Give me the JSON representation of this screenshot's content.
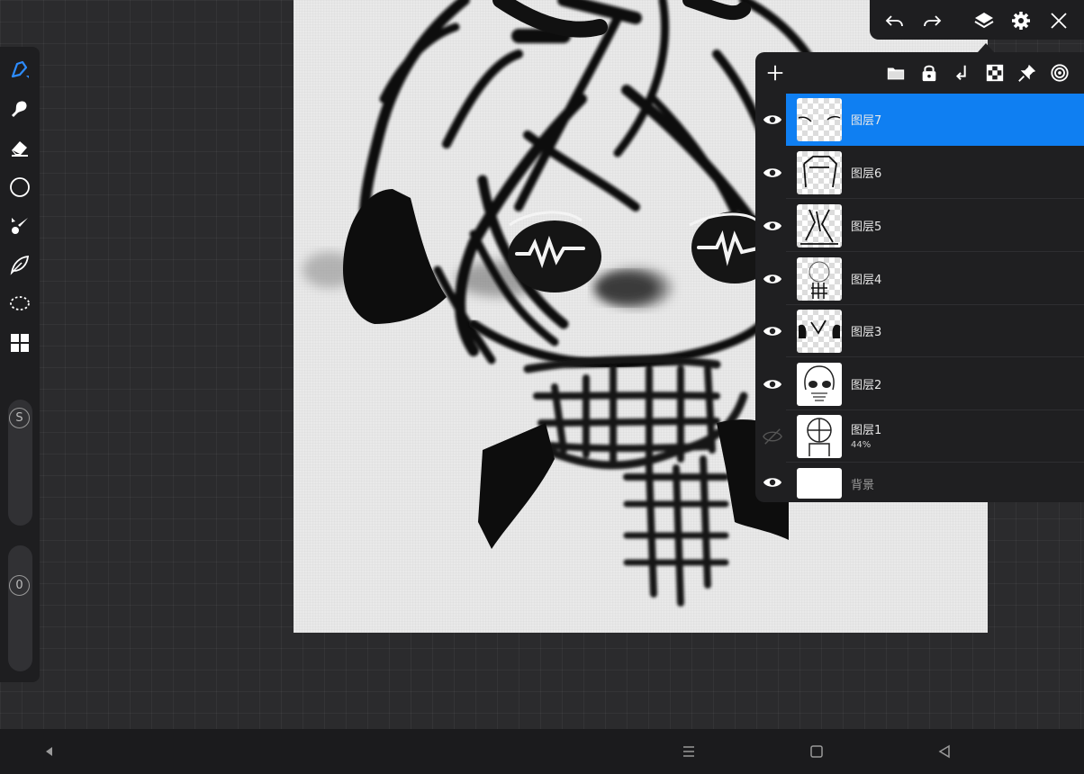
{
  "toolbar": {
    "tools": [
      {
        "name": "brush-icon",
        "active": true
      },
      {
        "name": "smudge-icon"
      },
      {
        "name": "eraser-icon"
      },
      {
        "name": "shape-circle-icon"
      },
      {
        "name": "fill-brush-icon"
      },
      {
        "name": "leaf-icon"
      },
      {
        "name": "lasso-icon"
      },
      {
        "name": "grid-icon"
      }
    ],
    "size_slider_label": "S",
    "opacity_slider_label": "0"
  },
  "topbar": {
    "icons": [
      "undo-icon",
      "redo-icon",
      "layers-icon",
      "settings-icon",
      "close-icon"
    ]
  },
  "layers_panel": {
    "header_icons": [
      "add-icon",
      "folder-icon",
      "lock-icon",
      "merge-down-icon",
      "checker-icon",
      "pin-icon",
      "target-icon"
    ],
    "layers": [
      {
        "name": "图层7",
        "visible": true,
        "selected": true,
        "opacity": ""
      },
      {
        "name": "图层6",
        "visible": true,
        "selected": false,
        "opacity": ""
      },
      {
        "name": "图层5",
        "visible": true,
        "selected": false,
        "opacity": ""
      },
      {
        "name": "图层4",
        "visible": true,
        "selected": false,
        "opacity": ""
      },
      {
        "name": "图层3",
        "visible": true,
        "selected": false,
        "opacity": ""
      },
      {
        "name": "图层2",
        "visible": true,
        "selected": false,
        "opacity": ""
      },
      {
        "name": "图层1",
        "visible": false,
        "selected": false,
        "opacity": "44%"
      },
      {
        "name": "背景",
        "visible": true,
        "selected": false,
        "opacity": ""
      }
    ]
  },
  "colors": {
    "accent": "#0f7ff2",
    "panel": "#1f1f21",
    "canvas": "#e9e9e9"
  },
  "navbar": {
    "icons": [
      "back-triangle-icon",
      "menu-icon",
      "home-square-icon",
      "recent-triangle-icon"
    ]
  }
}
